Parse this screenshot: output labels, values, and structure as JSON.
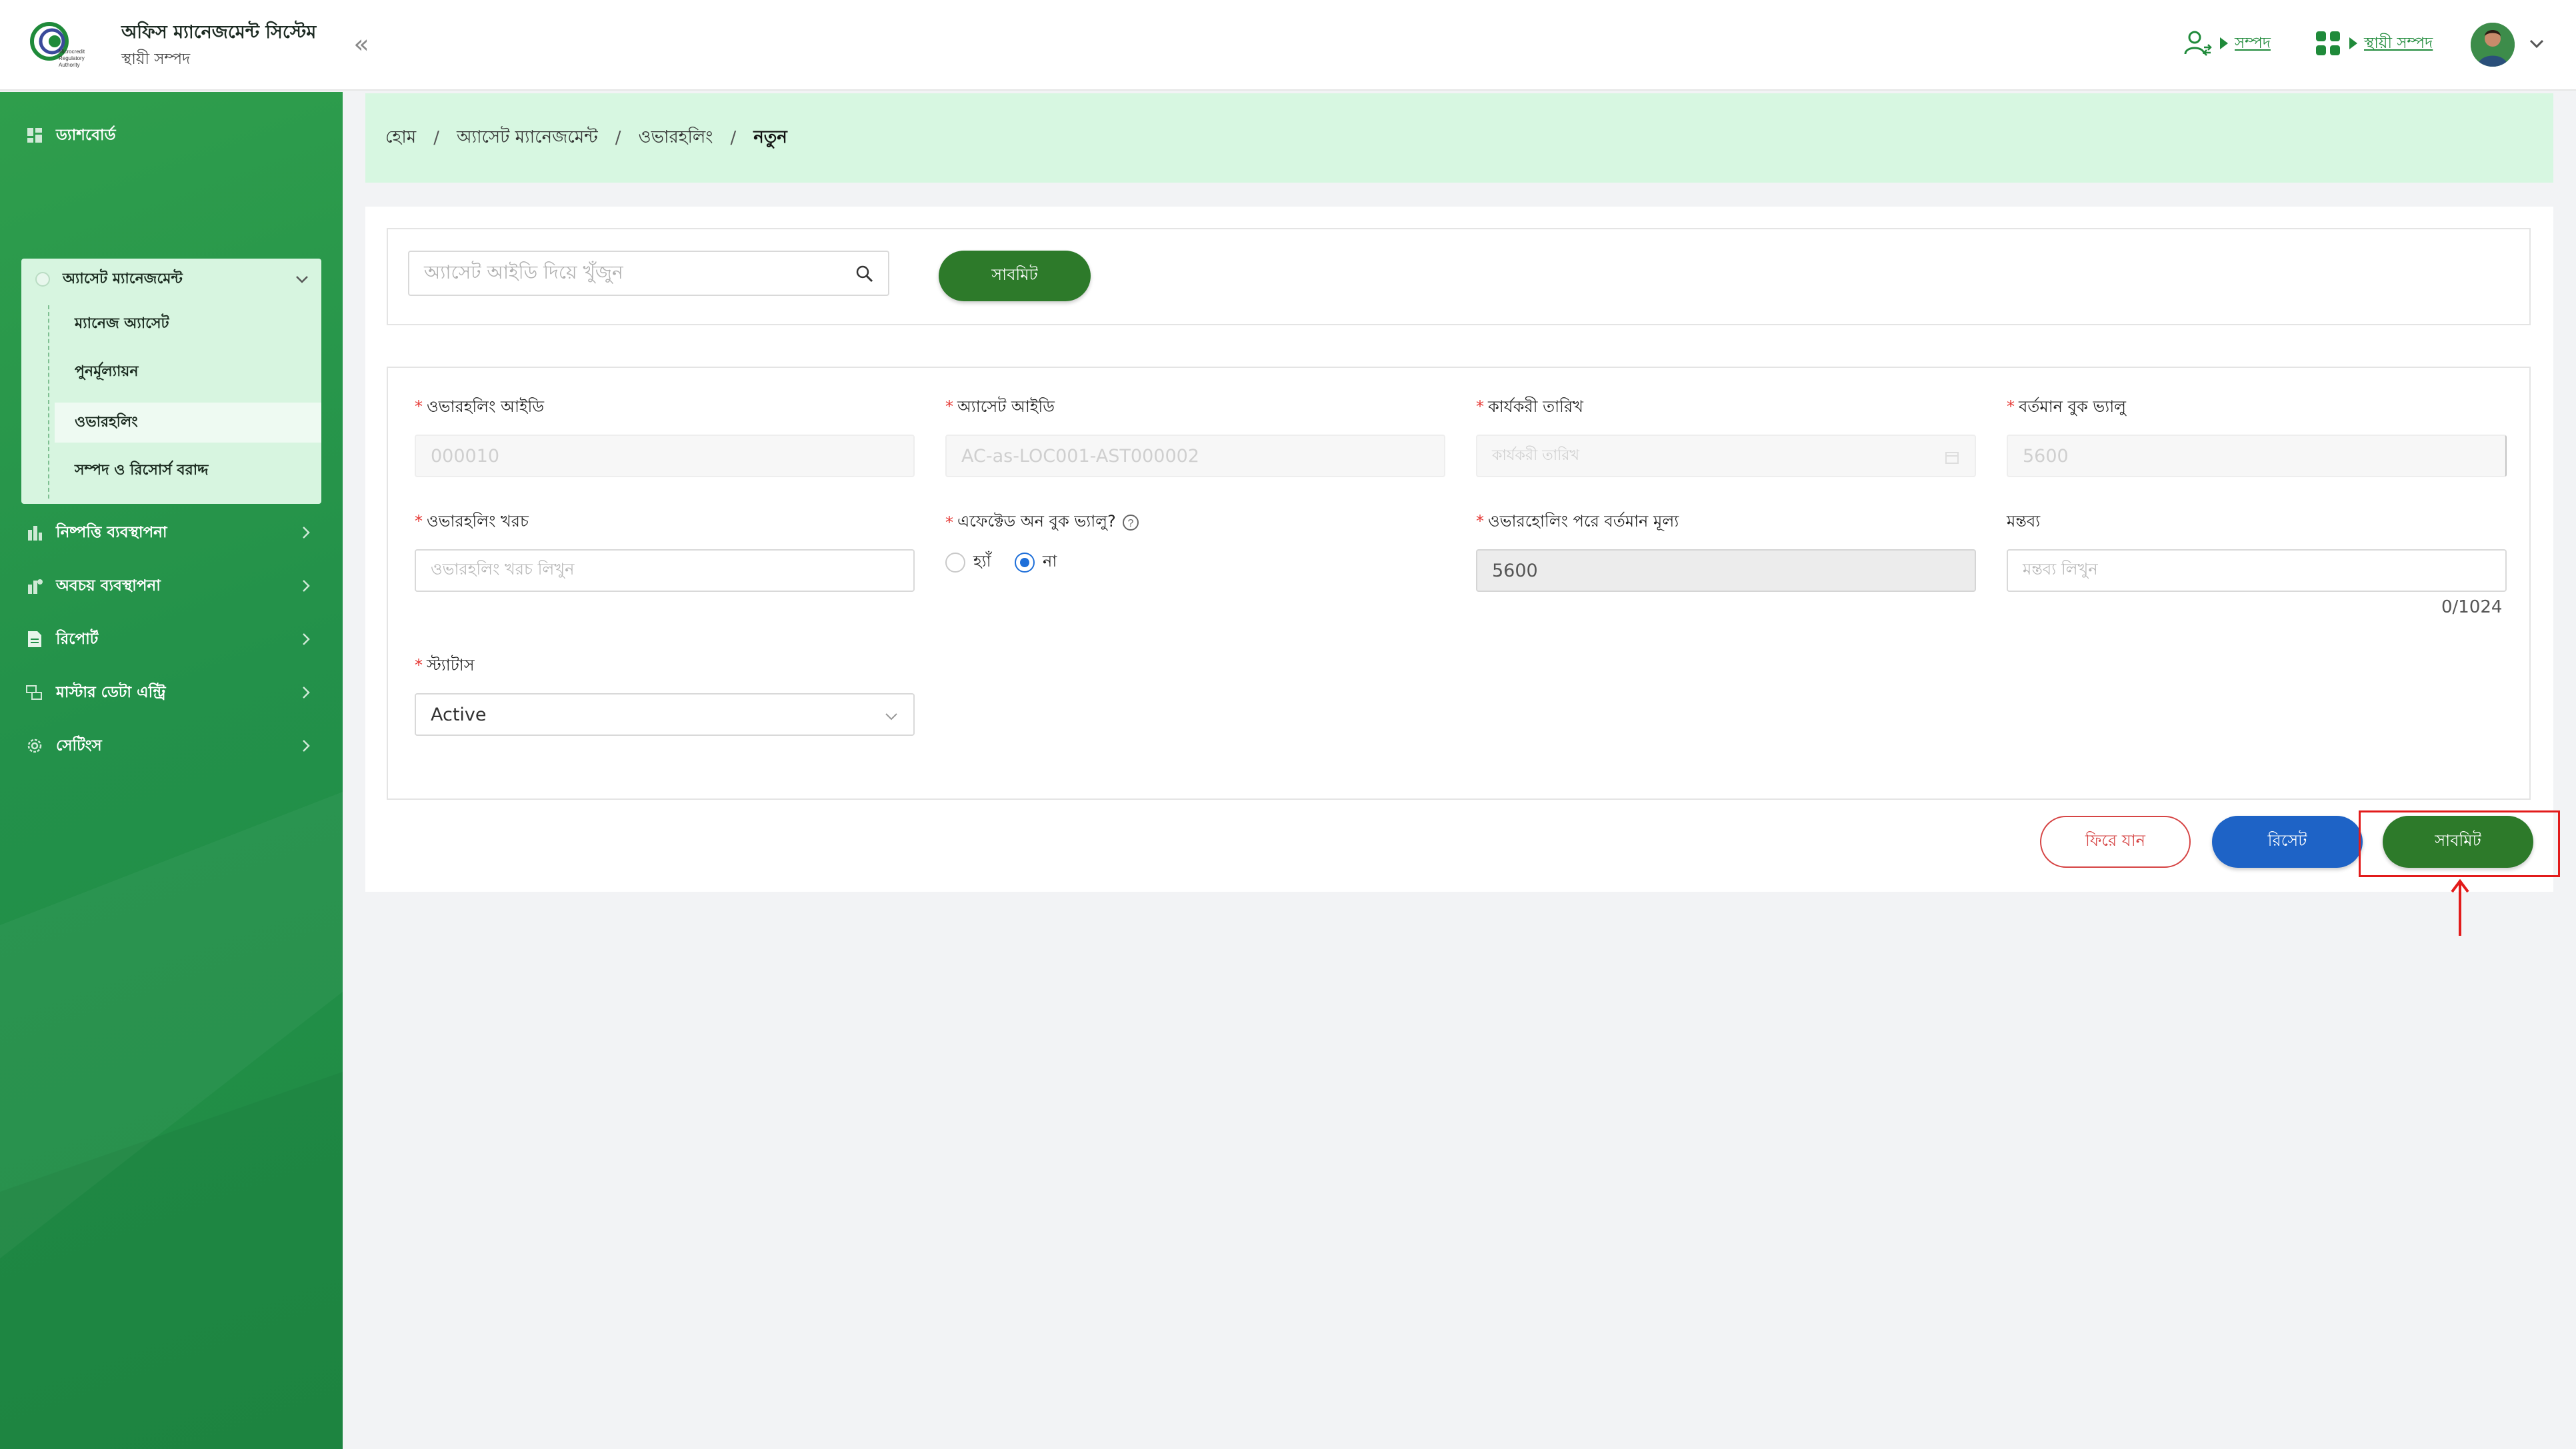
{
  "header": {
    "app_title": "অফিস ম্যানেজমেন্ট সিস্টেম",
    "app_subtitle": "স্থায়ী সম্পদ",
    "logo_text": "Microcredit Regulatory Authority",
    "link1_label": "সম্পদ",
    "link2_label": "স্থায়ী সম্পদ",
    "collapse_glyph": "«"
  },
  "sidebar": {
    "items": [
      {
        "label": "ড্যাশবোর্ড",
        "icon": "dashboard-icon"
      },
      {
        "label": "নিষ্পত্তি ব্যবস্থাপনা",
        "icon": "disposal-icon"
      },
      {
        "label": "অবচয় ব্যবস্থাপনা",
        "icon": "depreciation-icon"
      },
      {
        "label": "রিপোর্ট",
        "icon": "report-icon"
      },
      {
        "label": "মাস্টার ডেটা এন্ট্রি",
        "icon": "master-data-icon"
      },
      {
        "label": "সেটিংস",
        "icon": "settings-icon"
      }
    ],
    "group": {
      "label": "অ্যাসেট ম্যানেজমেন্ট",
      "subitems": [
        {
          "label": "ম্যানেজ অ্যাসেট"
        },
        {
          "label": "পুনর্মূল্যায়ন"
        },
        {
          "label": "ওভারহলিং"
        },
        {
          "label": "সম্পদ ও রিসোর্স বরাদ্দ"
        }
      ]
    }
  },
  "breadcrumb": {
    "items": [
      "হোম",
      "অ্যাসেট ম্যানেজমেন্ট",
      "ওভারহলিং",
      "নতুন"
    ],
    "separator": "/"
  },
  "search": {
    "placeholder": "অ্যাসেট আইডি দিয়ে খুঁজুন",
    "submit_label": "সাবমিট"
  },
  "form": {
    "overhauling_id": {
      "label": "ওভারহলিং আইডি",
      "value": "000010"
    },
    "asset_id": {
      "label": "অ্যাসেট আইডি",
      "value": "AC-as-LOC001-AST000002"
    },
    "effective_date": {
      "label": "কার্যকরী তারিখ",
      "placeholder": "কার্যকরী তারিখ"
    },
    "current_book_value": {
      "label": "বর্তমান বুক ভ্যালু",
      "value": "5600"
    },
    "overhauling_cost": {
      "label": "ওভারহলিং খরচ",
      "placeholder": "ওভারহলিং খরচ লিখুন"
    },
    "affected_book_value": {
      "label": "এফেক্টেড অন বুক ভ্যালু?",
      "yes": "হ্যাঁ",
      "no": "না",
      "selected": "no"
    },
    "value_after": {
      "label": "ওভারহোলিং পরে বর্তমান মূল্য",
      "value": "5600"
    },
    "remarks": {
      "label": "মন্তব্য",
      "placeholder": "মন্তব্য লিখুন",
      "counter": "0/1024"
    },
    "status": {
      "label": "স্ট্যাটাস",
      "value": "Active"
    }
  },
  "actions": {
    "back_label": "ফিরে যান",
    "reset_label": "রিসেট",
    "submit_label": "সাবমিট"
  },
  "colors": {
    "sidebar_green": "#23914a",
    "primary_green": "#2d7a2a",
    "reset_blue": "#1e63c6",
    "back_red": "#d64545",
    "highlight_red": "#e21b1b",
    "breadcrumb_bg": "#d7f7e1"
  }
}
